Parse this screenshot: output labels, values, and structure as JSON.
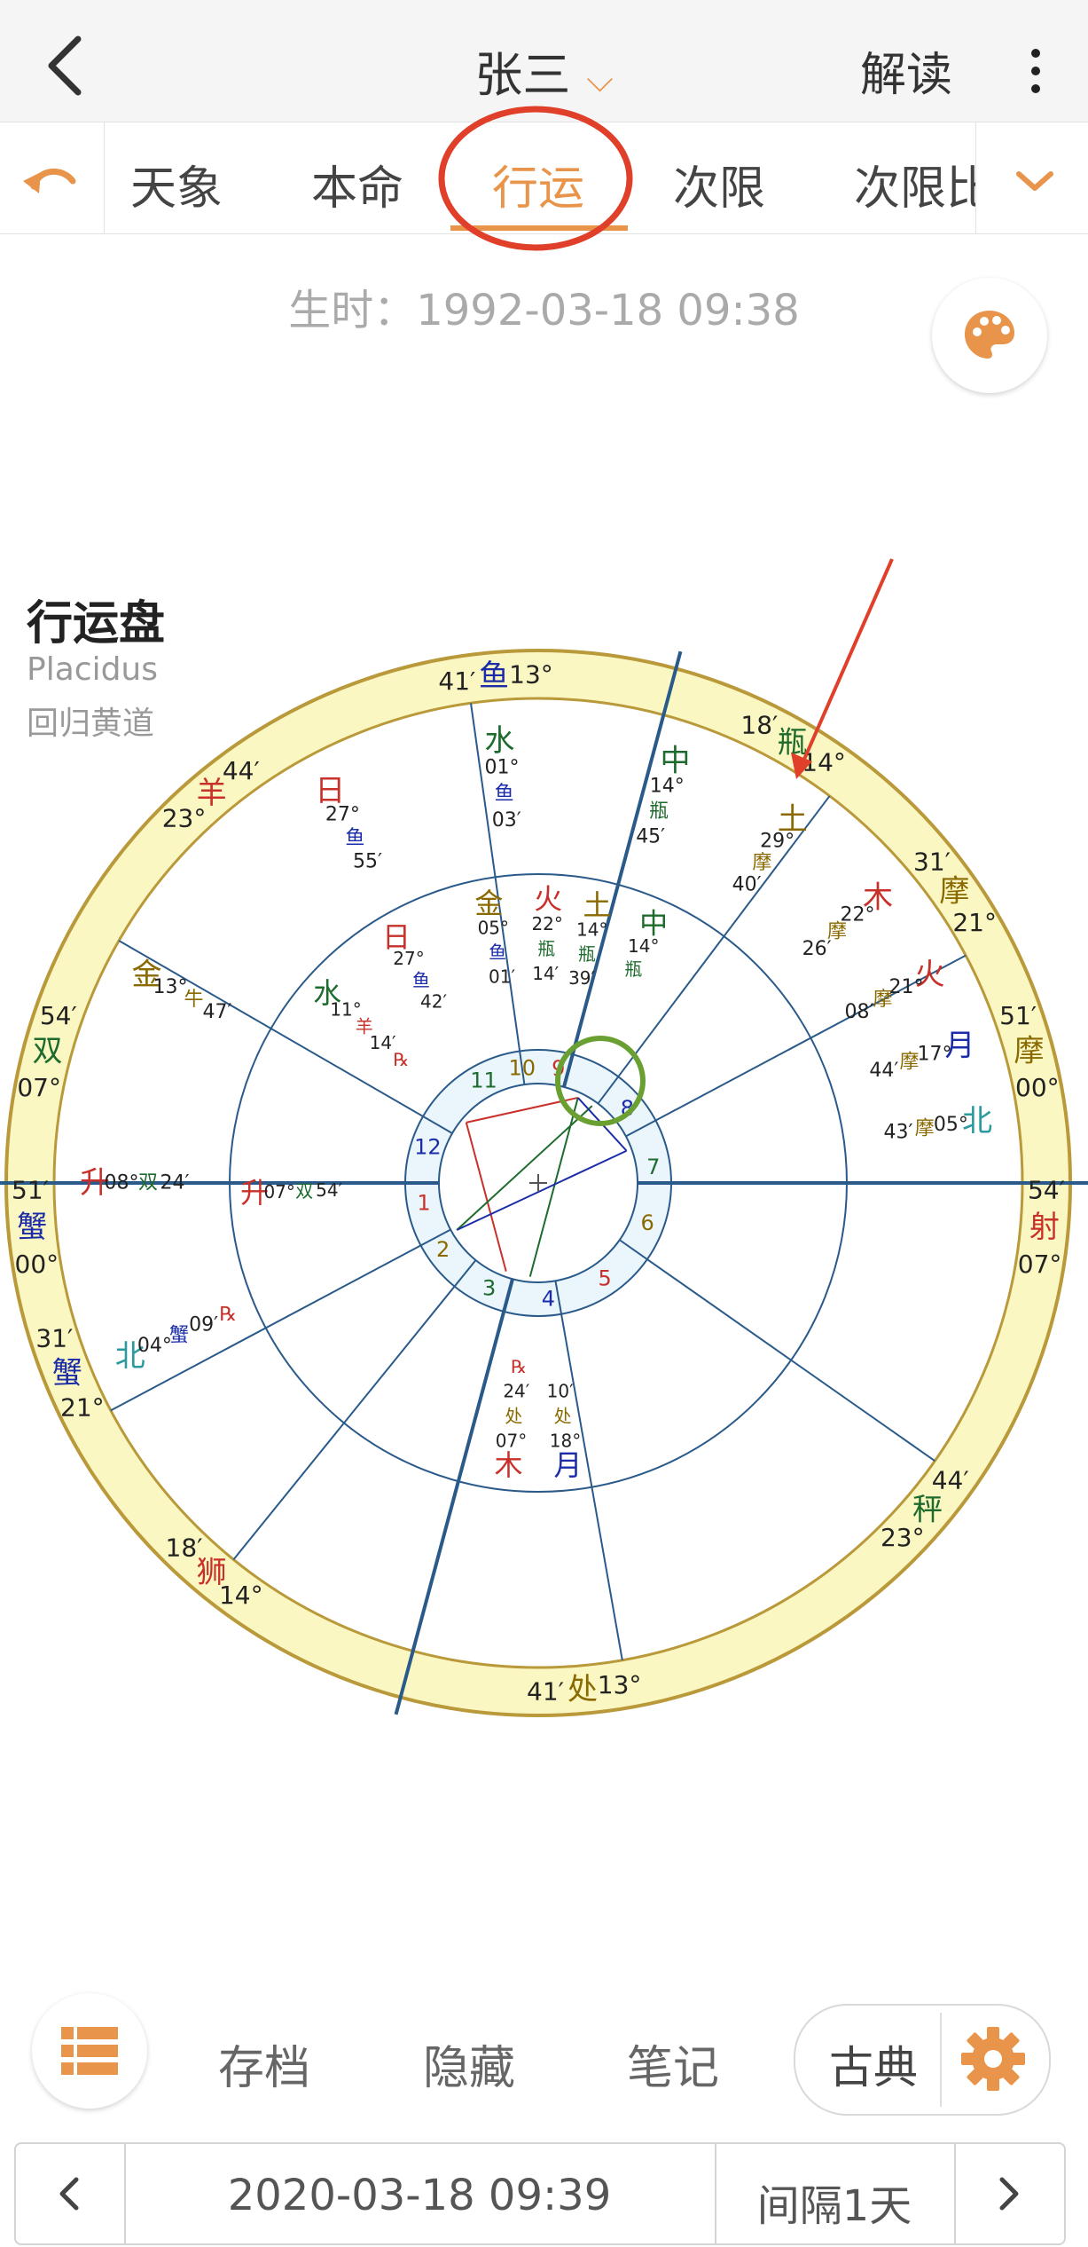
{
  "header": {
    "title": "张三",
    "right_label": "解读"
  },
  "tabs": [
    "天象",
    "本命",
    "行运",
    "次限",
    "次限比"
  ],
  "active_tab": "行运",
  "birth_time": "生时：1992-03-18 09:38",
  "chart_header": {
    "title": "行运盘",
    "house_system": "Placidus",
    "zodiac": "回归黄道"
  },
  "chart_data": {
    "type": "astrology-wheel",
    "outer_ring_labels": [
      {
        "text": "41′",
        "c": "#222"
      },
      {
        "text": "鱼",
        "c": "#1a2ca8"
      },
      {
        "text": "13°",
        "c": "#222"
      },
      {
        "text": "18′",
        "c": "#222"
      },
      {
        "text": "瓶",
        "c": "#1e6b2e"
      },
      {
        "text": "14°",
        "c": "#222"
      },
      {
        "text": "31′",
        "c": "#222"
      },
      {
        "text": "摩",
        "c": "#8a6a00"
      },
      {
        "text": "21°",
        "c": "#222"
      },
      {
        "text": "51′",
        "c": "#222"
      },
      {
        "text": "摩",
        "c": "#8a6a00"
      },
      {
        "text": "00°",
        "c": "#222"
      },
      {
        "text": "54′",
        "c": "#222"
      },
      {
        "text": "射",
        "c": "#c8302a"
      },
      {
        "text": "07°",
        "c": "#222"
      },
      {
        "text": "44′",
        "c": "#222"
      },
      {
        "text": "秤",
        "c": "#1e6b2e"
      },
      {
        "text": "23°",
        "c": "#222"
      },
      {
        "text": "13°",
        "c": "#222"
      },
      {
        "text": "处",
        "c": "#8a6a00"
      },
      {
        "text": "41′",
        "c": "#222"
      },
      {
        "text": "14°",
        "c": "#222"
      },
      {
        "text": "狮",
        "c": "#c8302a"
      },
      {
        "text": "18′",
        "c": "#222"
      },
      {
        "text": "21°",
        "c": "#222"
      },
      {
        "text": "蟹",
        "c": "#1a2ca8"
      },
      {
        "text": "31′",
        "c": "#222"
      },
      {
        "text": "00°",
        "c": "#222"
      },
      {
        "text": "蟹",
        "c": "#1a2ca8"
      },
      {
        "text": "51′",
        "c": "#222"
      },
      {
        "text": "07°",
        "c": "#222"
      },
      {
        "text": "双",
        "c": "#1e6b2e"
      },
      {
        "text": "54′",
        "c": "#222"
      },
      {
        "text": "23°",
        "c": "#222"
      },
      {
        "text": "羊",
        "c": "#c8302a"
      },
      {
        "text": "44′",
        "c": "#222"
      }
    ],
    "transit_planet_labels": [
      {
        "text": "水",
        "c": "#1e6b2e"
      },
      {
        "text": "01°",
        "c": "#222"
      },
      {
        "text": "鱼",
        "c": "#1a2ca8"
      },
      {
        "text": "03′",
        "c": "#222"
      },
      {
        "text": "中",
        "c": "#1e6b2e"
      },
      {
        "text": "14°",
        "c": "#222"
      },
      {
        "text": "瓶",
        "c": "#1e6b2e"
      },
      {
        "text": "45′",
        "c": "#222"
      },
      {
        "text": "土",
        "c": "#8a6a00"
      },
      {
        "text": "29°",
        "c": "#222"
      },
      {
        "text": "摩",
        "c": "#8a6a00"
      },
      {
        "text": "40′",
        "c": "#222"
      },
      {
        "text": "木",
        "c": "#c8302a"
      },
      {
        "text": "22°",
        "c": "#222"
      },
      {
        "text": "摩",
        "c": "#8a6a00"
      },
      {
        "text": "26′",
        "c": "#222"
      },
      {
        "text": "火",
        "c": "#c8302a"
      },
      {
        "text": "21°",
        "c": "#222"
      },
      {
        "text": "摩",
        "c": "#8a6a00"
      },
      {
        "text": "08′",
        "c": "#222"
      },
      {
        "text": "月",
        "c": "#1a2ca8"
      },
      {
        "text": "17°",
        "c": "#222"
      },
      {
        "text": "摩",
        "c": "#8a6a00"
      },
      {
        "text": "44′",
        "c": "#222"
      },
      {
        "text": "北",
        "c": "#2a9aa0"
      },
      {
        "text": "05°",
        "c": "#222"
      },
      {
        "text": "摩",
        "c": "#8a6a00"
      },
      {
        "text": "43′",
        "c": "#222"
      },
      {
        "text": "日",
        "c": "#c8302a"
      },
      {
        "text": "27°",
        "c": "#222"
      },
      {
        "text": "鱼",
        "c": "#1a2ca8"
      },
      {
        "text": "55′",
        "c": "#222"
      },
      {
        "text": "金",
        "c": "#8a6a00"
      },
      {
        "text": "13°",
        "c": "#222"
      },
      {
        "text": "牛",
        "c": "#8a6a00"
      },
      {
        "text": "47′",
        "c": "#222"
      },
      {
        "text": "升",
        "c": "#c8302a"
      },
      {
        "text": "08°",
        "c": "#222"
      },
      {
        "text": "双",
        "c": "#1e6b2e"
      },
      {
        "text": "24′",
        "c": "#222"
      },
      {
        "text": "北",
        "c": "#2a9aa0"
      },
      {
        "text": "04°",
        "c": "#222"
      },
      {
        "text": "蟹",
        "c": "#1a2ca8"
      },
      {
        "text": "09′",
        "c": "#222"
      },
      {
        "text": "℞",
        "c": "#c8302a"
      }
    ],
    "natal_planet_labels": [
      {
        "text": "金",
        "c": "#8a6a00"
      },
      {
        "text": "05°",
        "c": "#222"
      },
      {
        "text": "鱼",
        "c": "#1a2ca8"
      },
      {
        "text": "01′",
        "c": "#222"
      },
      {
        "text": "火",
        "c": "#c8302a"
      },
      {
        "text": "22°",
        "c": "#222"
      },
      {
        "text": "瓶",
        "c": "#1e6b2e"
      },
      {
        "text": "14′",
        "c": "#222"
      },
      {
        "text": "土",
        "c": "#8a6a00"
      },
      {
        "text": "14°",
        "c": "#222"
      },
      {
        "text": "瓶",
        "c": "#1e6b2e"
      },
      {
        "text": "39′",
        "c": "#222"
      },
      {
        "text": "中",
        "c": "#1e6b2e"
      },
      {
        "text": "14°",
        "c": "#222"
      },
      {
        "text": "瓶",
        "c": "#1e6b2e"
      },
      {
        "text": "日",
        "c": "#c8302a"
      },
      {
        "text": "27°",
        "c": "#222"
      },
      {
        "text": "鱼",
        "c": "#1a2ca8"
      },
      {
        "text": "42′",
        "c": "#222"
      },
      {
        "text": "水",
        "c": "#1e6b2e"
      },
      {
        "text": "11°",
        "c": "#222"
      },
      {
        "text": "羊",
        "c": "#c8302a"
      },
      {
        "text": "14′",
        "c": "#222"
      },
      {
        "text": "℞",
        "c": "#c8302a"
      },
      {
        "text": "升",
        "c": "#c8302a"
      },
      {
        "text": "07°",
        "c": "#222"
      },
      {
        "text": "双",
        "c": "#1e6b2e"
      },
      {
        "text": "54′",
        "c": "#222"
      },
      {
        "text": "木",
        "c": "#c8302a"
      },
      {
        "text": "07°",
        "c": "#222"
      },
      {
        "text": "处",
        "c": "#8a6a00"
      },
      {
        "text": "24′",
        "c": "#222"
      },
      {
        "text": "℞",
        "c": "#c8302a"
      },
      {
        "text": "月",
        "c": "#1a2ca8"
      },
      {
        "text": "18°",
        "c": "#222"
      },
      {
        "text": "处",
        "c": "#8a6a00"
      },
      {
        "text": "10′",
        "c": "#222"
      }
    ],
    "house_numbers": [
      {
        "text": "11",
        "c": "#1e6b2e"
      },
      {
        "text": "10",
        "c": "#8a6a00"
      },
      {
        "text": "9",
        "c": "#c8302a"
      },
      {
        "text": "8",
        "c": "#1a2ca8"
      },
      {
        "text": "7",
        "c": "#1e6b2e"
      },
      {
        "text": "6",
        "c": "#8a6a00"
      },
      {
        "text": "5",
        "c": "#c8302a"
      },
      {
        "text": "4",
        "c": "#1a2ca8"
      },
      {
        "text": "3",
        "c": "#1e6b2e"
      },
      {
        "text": "2",
        "c": "#8a6a00"
      },
      {
        "text": "1",
        "c": "#c8302a"
      },
      {
        "text": "12",
        "c": "#1a2ca8"
      }
    ],
    "colors": {
      "ring": "#fbf7c2",
      "ring_border": "#b9993a",
      "line": "#2a5a8a",
      "accent": "#e8944a",
      "annot_red": "#e0402a",
      "annot_green": "#6aa032"
    }
  },
  "toolbar": {
    "archive": "存档",
    "hide": "隐藏",
    "notes": "笔记",
    "classic": "古典"
  },
  "datebar": {
    "date": "2020-03-18 09:39",
    "interval": "间隔1天"
  }
}
